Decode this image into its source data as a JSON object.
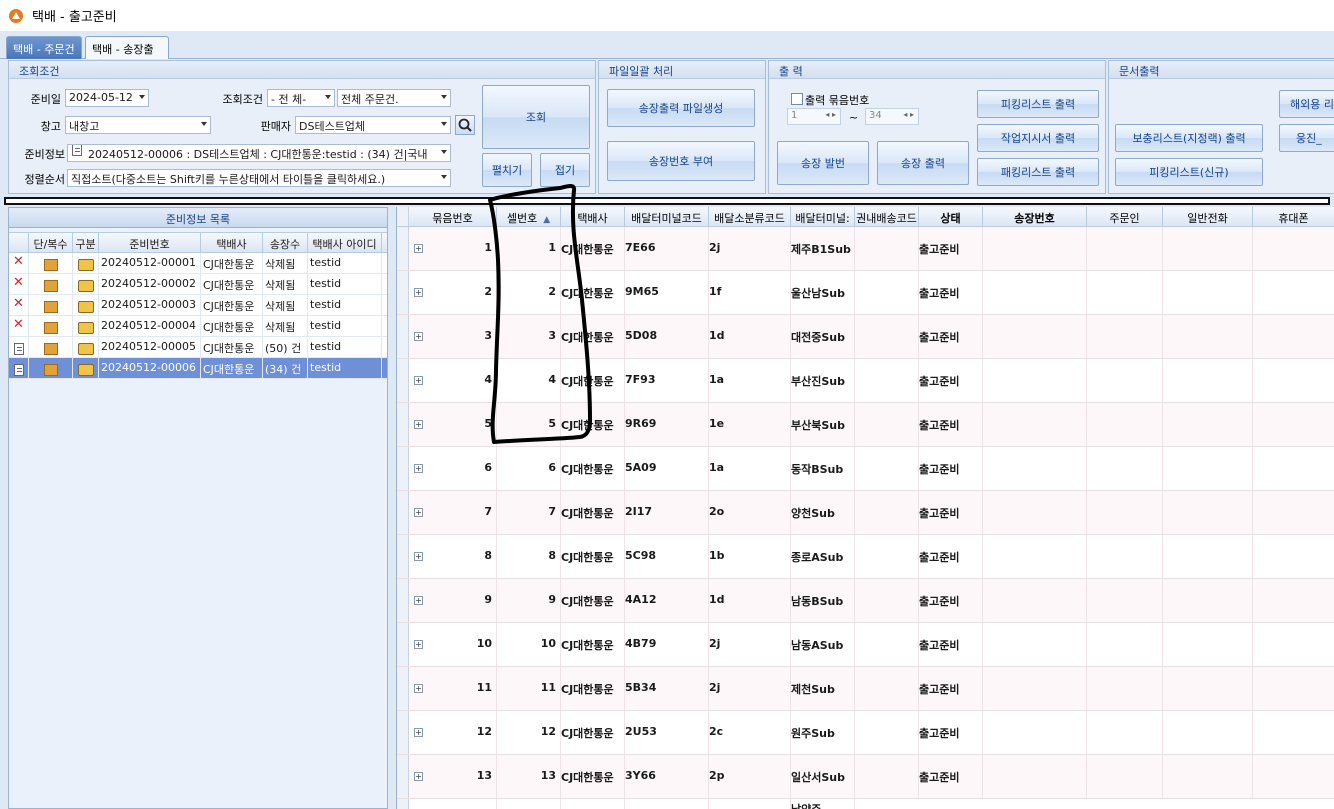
{
  "window": {
    "title": "택배 - 출고준비"
  },
  "tabs": [
    {
      "label": "택배 - 주문건"
    },
    {
      "label": "택배 - 송장출력"
    }
  ],
  "search_group": {
    "title": "조회조건",
    "date_label": "준비일",
    "date_value": "2024-05-12",
    "cond_label": "조회조건",
    "cond_value": "- 전  체-",
    "cond_value2": "전체 주문건.",
    "warehouse_label": "창고",
    "warehouse_value": "내창고",
    "seller_label": "판매자",
    "seller_value": "DS테스트업체",
    "prep_label": "준비정보",
    "prep_value": "20240512-00006 : DS테스트업체 : CJ대한통운:testid : (34) 건|국내",
    "sort_label": "정렬순서",
    "sort_value": "직접소트(다중소트는 Shift키를 누른상태에서 타이틀을 클릭하세요.)",
    "search_btn": "조회",
    "expand_btn": "펼치기",
    "collapse_btn": "접기"
  },
  "file_group": {
    "title": "파일일괄 처리",
    "btn1": "송장출력 파일생성",
    "btn2": "송장번호 부여"
  },
  "print_group": {
    "title": "출  력",
    "bundle_label": "출력 묶음번호",
    "from_value": "1",
    "tilde": "~",
    "to_value": "34",
    "btn_issue": "송장 발번",
    "btn_print": "송장 출력",
    "btn_picking": "피킹리스트 출력",
    "btn_work": "작업지시서 출력",
    "btn_packing": "패킹리스트 출력"
  },
  "doc_group": {
    "title": "문서출력",
    "btn1": "보충리스트(지정랙) 출력",
    "btn2": "피킹리스트(신규)",
    "btn3": "해외용 리",
    "btn4": "웅진_"
  },
  "left": {
    "title": "준비정보 목록",
    "columns": [
      "",
      "단/복수",
      "구분",
      "준비번호",
      "택배사",
      "송장수",
      "택배사 아이디"
    ],
    "rows": [
      {
        "status": "x",
        "no": "20240512-00001",
        "carrier": "CJ대한통운",
        "count": "삭제됨",
        "id": "testid"
      },
      {
        "status": "x",
        "no": "20240512-00002",
        "carrier": "CJ대한통운",
        "count": "삭제됨",
        "id": "testid"
      },
      {
        "status": "x",
        "no": "20240512-00003",
        "carrier": "CJ대한통운",
        "count": "삭제됨",
        "id": "testid"
      },
      {
        "status": "x",
        "no": "20240512-00004",
        "carrier": "CJ대한통운",
        "count": "삭제됨",
        "id": "testid"
      },
      {
        "status": "doc",
        "no": "20240512-00005",
        "carrier": "CJ대한통운",
        "count": "(50) 건",
        "id": "testid"
      },
      {
        "status": "doc",
        "no": "20240512-00006",
        "carrier": "CJ대한통운",
        "count": "(34) 건",
        "id": "testid"
      }
    ]
  },
  "grid": {
    "columns": [
      "묶음번호",
      "셀번호",
      "택배사",
      "배달터미널코드",
      "배달소분류코드",
      "배달터미널:",
      "권내배송코드",
      "상태",
      "송장번호",
      "주문인",
      "일반전화",
      "휴대폰"
    ],
    "sort_icon": "▲",
    "rows": [
      {
        "bundle": "1",
        "cell": "1",
        "carrier": "CJ대한통운",
        "terminal": "7E66",
        "sub": "2j",
        "tname": "제주B1Sub",
        "status": "출고준비"
      },
      {
        "bundle": "2",
        "cell": "2",
        "carrier": "CJ대한통운",
        "terminal": "9M65",
        "sub": "1f",
        "tname": "울산남Sub",
        "status": "출고준비"
      },
      {
        "bundle": "3",
        "cell": "3",
        "carrier": "CJ대한통운",
        "terminal": "5D08",
        "sub": "1d",
        "tname": "대전중Sub",
        "status": "출고준비"
      },
      {
        "bundle": "4",
        "cell": "4",
        "carrier": "CJ대한통운",
        "terminal": "7F93",
        "sub": "1a",
        "tname": "부산진Sub",
        "status": "출고준비"
      },
      {
        "bundle": "5",
        "cell": "5",
        "carrier": "CJ대한통운",
        "terminal": "9R69",
        "sub": "1e",
        "tname": "부산북Sub",
        "status": "출고준비"
      },
      {
        "bundle": "6",
        "cell": "6",
        "carrier": "CJ대한통운",
        "terminal": "5A09",
        "sub": "1a",
        "tname": "동작BSub",
        "status": "출고준비"
      },
      {
        "bundle": "7",
        "cell": "7",
        "carrier": "CJ대한통운",
        "terminal": "2I17",
        "sub": "2o",
        "tname": "양천Sub",
        "status": "출고준비"
      },
      {
        "bundle": "8",
        "cell": "8",
        "carrier": "CJ대한통운",
        "terminal": "5C98",
        "sub": "1b",
        "tname": "종로ASub",
        "status": "출고준비"
      },
      {
        "bundle": "9",
        "cell": "9",
        "carrier": "CJ대한통운",
        "terminal": "4A12",
        "sub": "1d",
        "tname": "남동BSub",
        "status": "출고준비"
      },
      {
        "bundle": "10",
        "cell": "10",
        "carrier": "CJ대한통운",
        "terminal": "4B79",
        "sub": "2j",
        "tname": "남동ASub",
        "status": "출고준비"
      },
      {
        "bundle": "11",
        "cell": "11",
        "carrier": "CJ대한통운",
        "terminal": "5B34",
        "sub": "2j",
        "tname": "제천Sub",
        "status": "출고준비"
      },
      {
        "bundle": "12",
        "cell": "12",
        "carrier": "CJ대한통운",
        "terminal": "2U53",
        "sub": "2c",
        "tname": "원주Sub",
        "status": "출고준비"
      },
      {
        "bundle": "13",
        "cell": "13",
        "carrier": "CJ대한통운",
        "terminal": "3Y66",
        "sub": "2p",
        "tname": "일산서Sub",
        "status": "출고준비"
      }
    ],
    "partial_next": "남양주"
  },
  "colors": {
    "selected_row": "#6f8fd6",
    "accent": "#15428b"
  }
}
